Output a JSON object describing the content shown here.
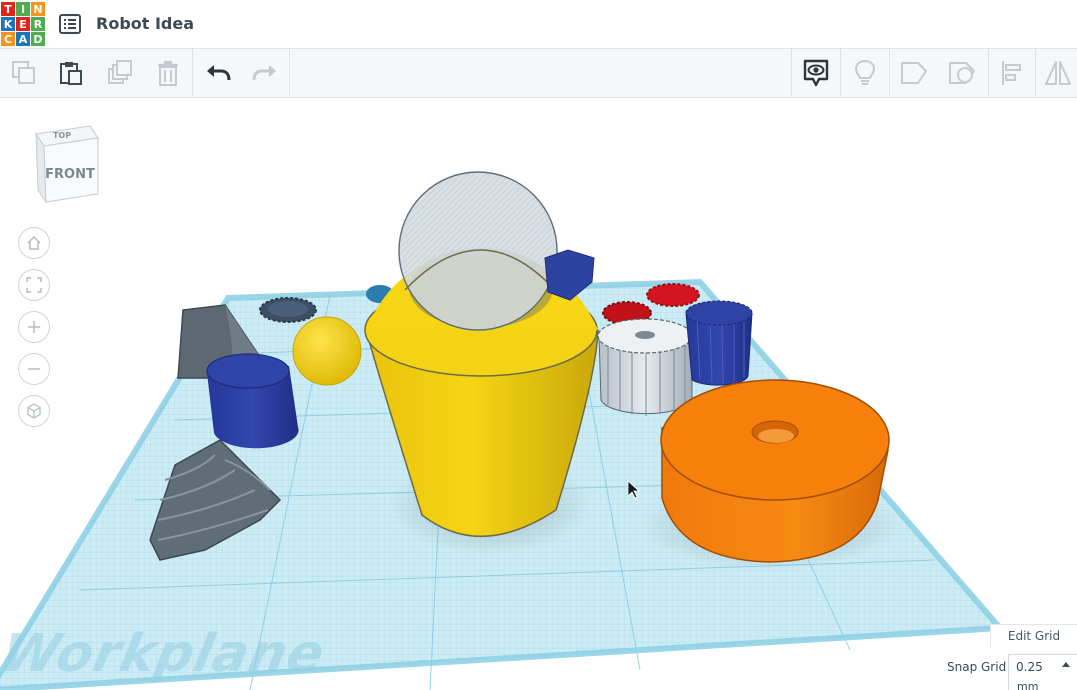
{
  "app": {
    "logo_letters": [
      "T",
      "I",
      "N",
      "K",
      "E",
      "R",
      "C",
      "A",
      "D"
    ],
    "logo_colors": [
      "#e2231a",
      "#4cae4c",
      "#f7941d",
      "#1c75bc",
      "#e2231a",
      "#4cae4c",
      "#f7941d",
      "#1c75bc",
      "#4cae4c"
    ],
    "menu_icon": "list-icon",
    "project_title": "Robot Idea"
  },
  "toolbar": {
    "left_icons": [
      "copy-icon",
      "paste-icon",
      "duplicate-icon",
      "delete-icon",
      "undo-icon",
      "redo-icon"
    ],
    "right_icons": [
      "show-notes-icon",
      "lightbulb-icon",
      "workplane-shape-icon",
      "group-icon",
      "align-icon",
      "mirror-icon"
    ]
  },
  "viewcube": {
    "top_label": "TOP",
    "front_label": "FRONT"
  },
  "nav_controls": [
    "home-view-icon",
    "fit-all-icon",
    "zoom-in-icon",
    "zoom-out-icon",
    "perspective-icon"
  ],
  "workplane": {
    "label": "Workplane",
    "grid_color": "#bfe6f0",
    "edge_color": "#a8ddf0"
  },
  "shapes": [
    "hexagon-gray",
    "gear-dark",
    "sphere-yellow",
    "cylinder-blue",
    "cone-yellow",
    "sphere-ghost",
    "polygon-blue",
    "gear-red",
    "gear-gray",
    "gear-blue",
    "torus-orange",
    "helix-gray"
  ],
  "colors": {
    "yellow": "#f2cf0e",
    "orange": "#f57d0b",
    "blue": "#2d43a2",
    "gray": "#6b7884",
    "red": "#d3151f"
  },
  "bottom_bar": {
    "edit_grid": "Edit Grid",
    "snap_grid_label": "Snap Grid",
    "snap_grid_value": "0.25",
    "snap_grid_unit": "mm"
  }
}
